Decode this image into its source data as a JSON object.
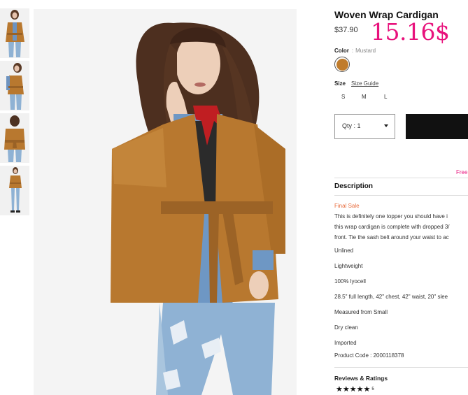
{
  "product": {
    "title": "Woven Wrap Cardigan",
    "price": "$37.90",
    "sale_price": "15.16$",
    "color_label": "Color",
    "color_sep": ":",
    "color_value": "Mustard",
    "swatch_color": "#c07c2c",
    "size_label": "Size",
    "size_guide": "Size Guide",
    "sizes": [
      "S",
      "M",
      "L"
    ],
    "qty": "Qty : 1",
    "free_text": "Free"
  },
  "description": {
    "heading": "Description",
    "final_sale": "Final Sale",
    "lines": [
      "This is definitely one topper you should have i",
      "this wrap cardigan is complete with dropped 3/",
      "front. Tie the sash belt around your waist to ac"
    ],
    "details": [
      "Unlined",
      "Lightweight",
      "100% lyocell",
      "28.5\" full length, 42\" chest, 42\" waist, 20\" slee",
      "Measured from Small",
      "Dry clean",
      "Imported",
      "Product Code : 2000118378"
    ]
  },
  "reviews": {
    "heading": "Reviews & Ratings",
    "stars": "★★★★★",
    "count": "5"
  },
  "colors": {
    "accent_pink": "#e8127c",
    "final_sale": "#e86c3d",
    "mustard": "#c07c2c"
  }
}
